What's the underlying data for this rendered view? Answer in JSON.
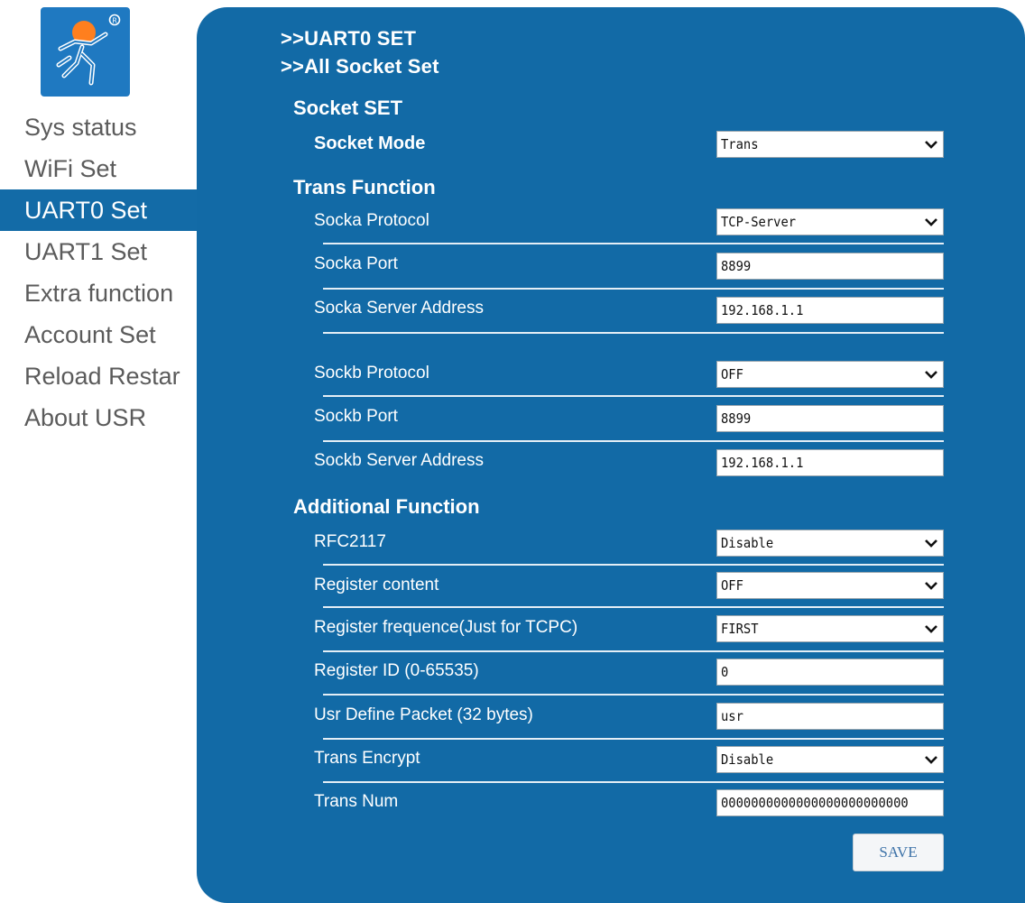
{
  "sidebar": {
    "items": [
      {
        "label": "Sys status"
      },
      {
        "label": "WiFi Set"
      },
      {
        "label": "UART0 Set"
      },
      {
        "label": "UART1 Set"
      },
      {
        "label": "Extra function"
      },
      {
        "label": "Account Set"
      },
      {
        "label": "Reload Restar"
      },
      {
        "label": "About USR"
      }
    ],
    "active_index": 2
  },
  "breadcrumbs": {
    "uart0": ">>UART0 SET",
    "all_socket": ">>All Socket Set"
  },
  "socket_set": {
    "heading": "Socket SET",
    "mode_label": "Socket Mode",
    "mode_value": "Trans"
  },
  "trans_function": {
    "heading": "Trans Function",
    "socka_protocol_label": "Socka Protocol",
    "socka_protocol_value": "TCP-Server",
    "socka_port_label": "Socka Port",
    "socka_port_value": "8899",
    "socka_server_label": "Socka Server Address",
    "socka_server_value": "192.168.1.1",
    "sockb_protocol_label": "Sockb Protocol",
    "sockb_protocol_value": "OFF",
    "sockb_port_label": "Sockb Port",
    "sockb_port_value": "8899",
    "sockb_server_label": "Sockb Server Address",
    "sockb_server_value": "192.168.1.1"
  },
  "additional_function": {
    "heading": "Additional Function",
    "rfc2117_label": "RFC2117",
    "rfc2117_value": "Disable",
    "register_content_label": "Register content",
    "register_content_value": "OFF",
    "register_frequence_label": "Register frequence(Just for TCPC)",
    "register_frequence_value": "FIRST",
    "register_id_label": "Register ID (0-65535)",
    "register_id_value": "0",
    "usr_packet_label": "Usr Define Packet (32 bytes)",
    "usr_packet_value": "usr",
    "trans_encrypt_label": "Trans Encrypt",
    "trans_encrypt_value": "Disable",
    "trans_num_label": "Trans Num",
    "trans_num_value": "0000000000000000000000000"
  },
  "save_label": "SAVE",
  "colors": {
    "panel": "#126aa6",
    "active_nav": "#136ba7",
    "logo_bg": "#1f79c1",
    "logo_head": "#ff7f1e"
  },
  "icons": {
    "logo": "usr-runner-logo",
    "dropdown": "chevron-down-icon"
  }
}
